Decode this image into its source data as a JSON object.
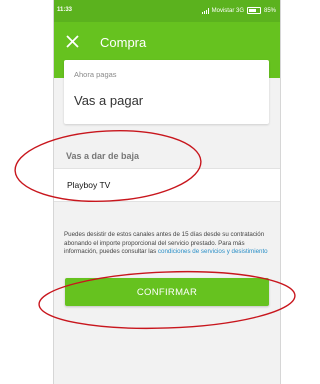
{
  "status_bar": {
    "time": "11:33",
    "carrier": "Movistar 3G",
    "battery": "85%"
  },
  "app_bar": {
    "title": "Compra",
    "close_icon": "close-icon"
  },
  "summary_card": {
    "label": "Ahora pagas",
    "value": "Vas a pagar"
  },
  "unsubscribe": {
    "section_title": "Vas a dar de baja",
    "items": [
      "Playboy TV"
    ]
  },
  "info": {
    "text": "Puedes desistir de estos canales antes de 15 días desde su contratación abonando el importe proporcional del servicio prestado. Para más información, puedes consultar las ",
    "link_text": "condiciones de servicios y desistimiento"
  },
  "actions": {
    "confirm_label": "CONFIRMAR"
  },
  "colors": {
    "primary_green": "#66c21f",
    "status_green": "#5bb21e",
    "annotation_red": "#c8161d",
    "link_blue": "#2a8fc7"
  }
}
